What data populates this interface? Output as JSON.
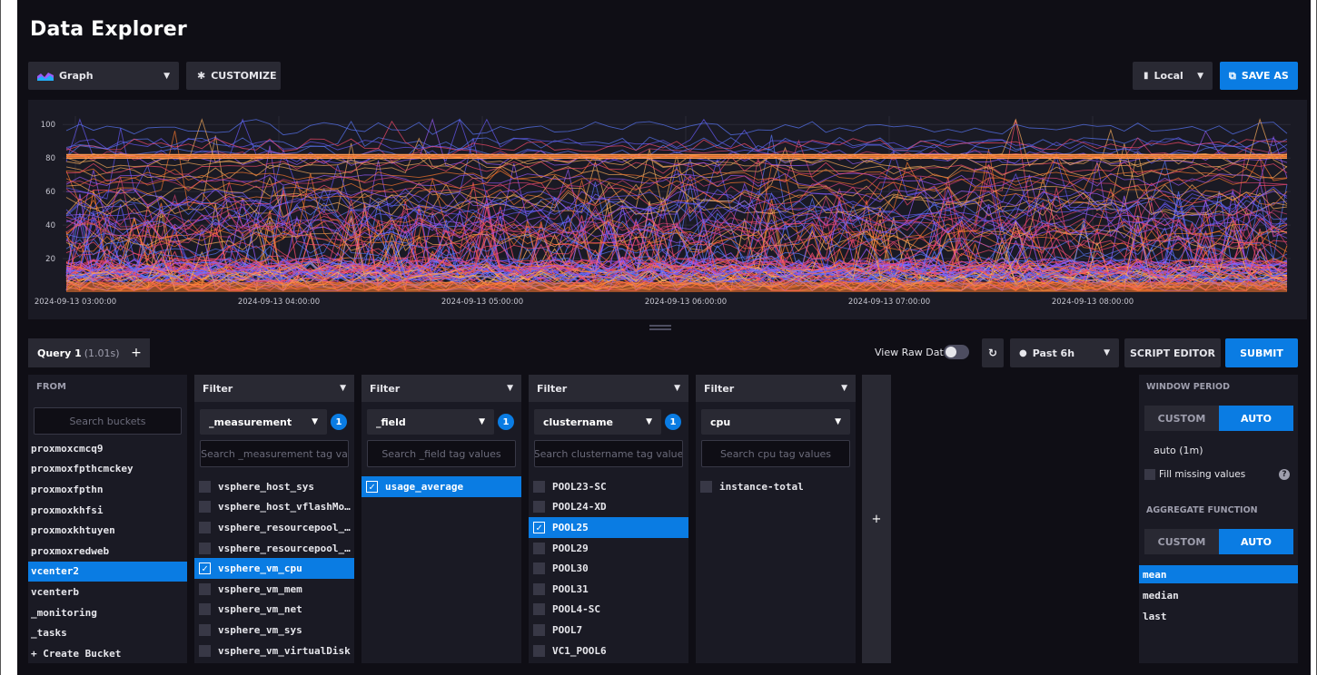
{
  "header": {
    "title": "Data Explorer",
    "view_type": "Graph",
    "customize": "CUSTOMIZE",
    "timezone": "Local",
    "save_as": "SAVE AS"
  },
  "graph": {
    "y_ticks": [
      "100",
      "80",
      "60",
      "40",
      "20"
    ],
    "x_ticks": [
      "2024-09-13 03:00:00",
      "2024-09-13 04:00:00",
      "2024-09-13 05:00:00",
      "2024-09-13 06:00:00",
      "2024-09-13 07:00:00",
      "2024-09-13 08:00:00"
    ]
  },
  "query_bar": {
    "tab_label": "Query 1",
    "tab_time": "(1.01s)",
    "add": "+",
    "view_raw": "View Raw Data",
    "time_range": "Past 6h",
    "script_editor": "SCRIPT EDITOR",
    "submit": "SUBMIT"
  },
  "from": {
    "label": "FROM",
    "search_placeholder": "Search buckets",
    "buckets": [
      {
        "label": "proxmoxcmcq9",
        "selected": false
      },
      {
        "label": "proxmoxfpthcmckey",
        "selected": false
      },
      {
        "label": "proxmoxfpthn",
        "selected": false
      },
      {
        "label": "proxmoxkhfsi",
        "selected": false
      },
      {
        "label": "proxmoxkhtuyen",
        "selected": false
      },
      {
        "label": "proxmoxredweb",
        "selected": false
      },
      {
        "label": "vcenter2",
        "selected": true
      },
      {
        "label": "vcenterb",
        "selected": false
      },
      {
        "label": "_monitoring",
        "selected": false
      },
      {
        "label": "_tasks",
        "selected": false
      },
      {
        "label": "+ Create Bucket",
        "selected": false
      }
    ]
  },
  "filters": [
    {
      "label": "Filter",
      "key": "_measurement",
      "count": "1",
      "search_placeholder": "Search _measurement tag va",
      "values": [
        {
          "label": "vsphere_host_sys",
          "selected": false
        },
        {
          "label": "vsphere_host_vflashMo…",
          "selected": false
        },
        {
          "label": "vsphere_resourcepool_…",
          "selected": false
        },
        {
          "label": "vsphere_resourcepool_…",
          "selected": false
        },
        {
          "label": "vsphere_vm_cpu",
          "selected": true
        },
        {
          "label": "vsphere_vm_mem",
          "selected": false
        },
        {
          "label": "vsphere_vm_net",
          "selected": false
        },
        {
          "label": "vsphere_vm_sys",
          "selected": false
        },
        {
          "label": "vsphere_vm_virtualDisk",
          "selected": false
        }
      ]
    },
    {
      "label": "Filter",
      "key": "_field",
      "count": "1",
      "search_placeholder": "Search _field tag values",
      "values": [
        {
          "label": "usage_average",
          "selected": true
        }
      ]
    },
    {
      "label": "Filter",
      "key": "clustername",
      "count": "1",
      "search_placeholder": "Search clustername tag value",
      "values": [
        {
          "label": "POOL23-SC",
          "selected": false
        },
        {
          "label": "POOL24-XD",
          "selected": false
        },
        {
          "label": "POOL25",
          "selected": true
        },
        {
          "label": "POOL29",
          "selected": false
        },
        {
          "label": "POOL30",
          "selected": false
        },
        {
          "label": "POOL31",
          "selected": false
        },
        {
          "label": "POOL4-SC",
          "selected": false
        },
        {
          "label": "POOL7",
          "selected": false
        },
        {
          "label": "VC1_POOL6",
          "selected": false
        }
      ]
    },
    {
      "label": "Filter",
      "key": "cpu",
      "count": "",
      "search_placeholder": "Search cpu tag values",
      "values": [
        {
          "label": "instance-total",
          "selected": false
        }
      ]
    }
  ],
  "add_filter": "+",
  "aggregate": {
    "window_label": "WINDOW PERIOD",
    "custom": "CUSTOM",
    "auto": "AUTO",
    "auto_value": "auto (1m)",
    "fill_missing": "Fill missing values",
    "function_label": "AGGREGATE FUNCTION",
    "functions": [
      {
        "label": "mean",
        "selected": true
      },
      {
        "label": "median",
        "selected": false
      },
      {
        "label": "last",
        "selected": false
      }
    ]
  },
  "colors": {
    "accent": "#0a7ce3",
    "bg": "#0f0e15",
    "panel": "#1a1a24",
    "series": [
      "#ff7a2e",
      "#ff4d6d",
      "#9b5cff",
      "#5b7bff",
      "#ffb05c",
      "#e0447a",
      "#6a5cff"
    ]
  }
}
